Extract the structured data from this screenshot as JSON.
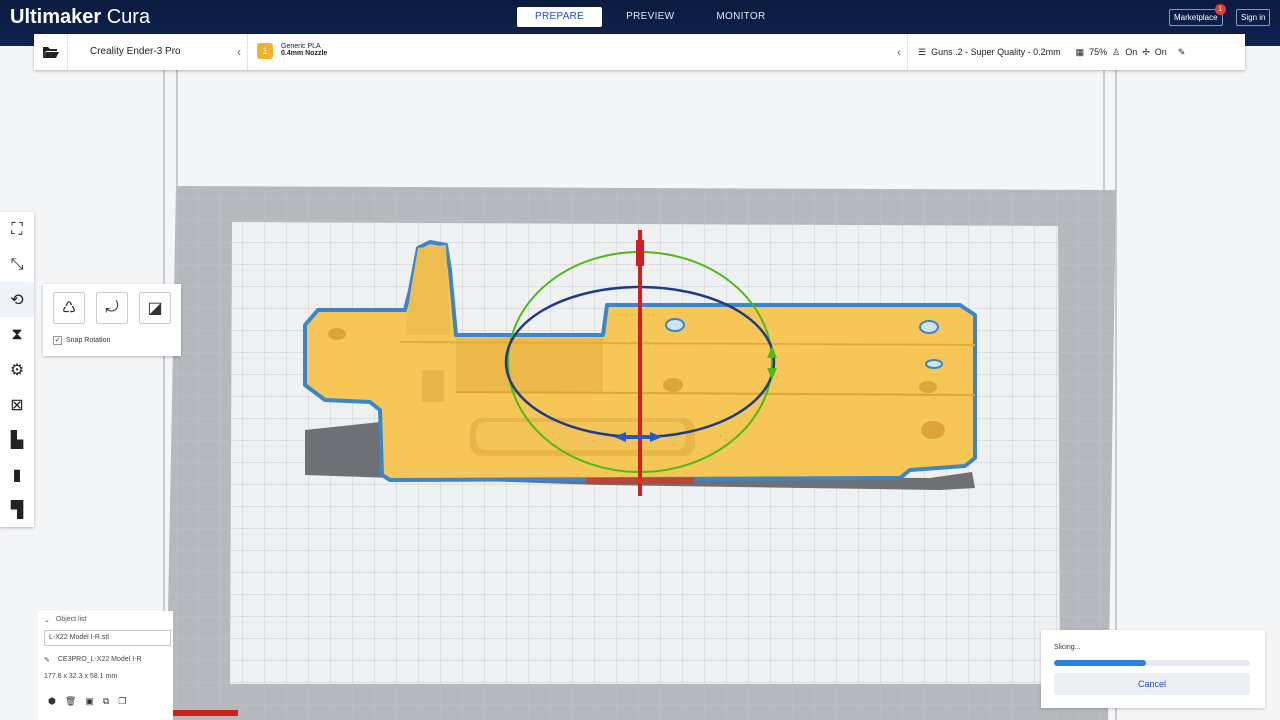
{
  "app": {
    "brand_bold": "Ultimaker",
    "brand_light": " Cura"
  },
  "stages": [
    {
      "label": "PREPARE",
      "active": true
    },
    {
      "label": "PREVIEW",
      "active": false
    },
    {
      "label": "MONITOR",
      "active": false
    }
  ],
  "header_buttons": {
    "marketplace": "Marketplace",
    "marketplace_badge": "1",
    "signin": "Sign in"
  },
  "printer": {
    "name": "Creality Ender-3 Pro"
  },
  "material": {
    "line1": "Generic PLA",
    "line2": "0.4mm Nozzle"
  },
  "print_settings": {
    "profile": "Guns .2 - Super Quality - 0.2mm",
    "infill": "75%",
    "support": "On",
    "adhesion": "On"
  },
  "tools": [
    {
      "name": "move"
    },
    {
      "name": "scale"
    },
    {
      "name": "rotate",
      "active": true
    },
    {
      "name": "mirror"
    },
    {
      "name": "per-model-settings"
    },
    {
      "name": "support-blocker"
    },
    {
      "name": "custom-tool-1"
    },
    {
      "name": "custom-tool-2"
    },
    {
      "name": "custom-tool-3"
    }
  ],
  "rotate_panel": {
    "snap_label": "Snap Rotation",
    "snap_checked": true
  },
  "object_list": {
    "header": "Object list",
    "selected_item": "L-X22 Model I-R.stl",
    "job_name": "CE3PRO_L-X22 Model I-R",
    "dimensions": "177.8 x 32.3 x 58.1 mm"
  },
  "slicing": {
    "label": "Slicing...",
    "progress": 0.47,
    "cancel_label": "Cancel"
  },
  "colors": {
    "header_bg": "#0d2350",
    "accent": "#1f4bd1",
    "model": "#f7c95c",
    "model_outline": "#3a86c8",
    "axis_red": "#d11f1f",
    "ring_blue": "#1e3a8a",
    "ring_green": "#4cbb17"
  }
}
